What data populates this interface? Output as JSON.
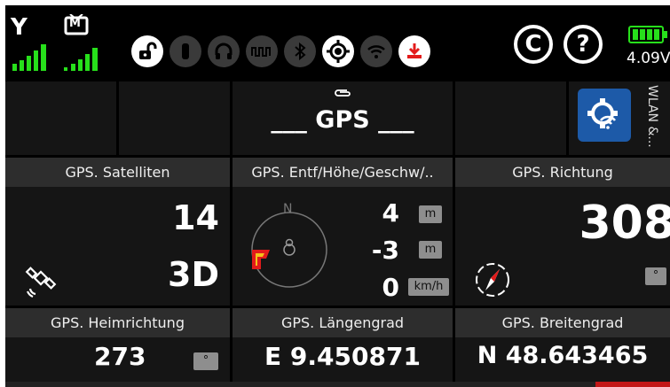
{
  "status": {
    "tx_antenna_glyph": "Y",
    "rx_tv_label": "M",
    "icons": [
      {
        "name": "unlocked-icon",
        "state": "on"
      },
      {
        "name": "vibration-icon",
        "state": "off"
      },
      {
        "name": "headphones-icon",
        "state": "off"
      },
      {
        "name": "sound-wave-icon",
        "state": "off"
      },
      {
        "name": "bluetooth-icon",
        "state": "off"
      },
      {
        "name": "gps-target-icon",
        "state": "on"
      },
      {
        "name": "wifi-icon",
        "state": "off"
      },
      {
        "name": "download-icon",
        "state": "on"
      }
    ],
    "reset_glyph": "C",
    "help_glyph": "?",
    "battery_voltage": "4.09V"
  },
  "top": {
    "title_icon": "paperclip-icon",
    "title": "___ GPS ___",
    "side_label": "WLAN &..."
  },
  "widgets": {
    "satellites": {
      "header": "GPS. Satelliten",
      "count": "14",
      "fix": "3D"
    },
    "distance": {
      "header": "GPS. Entf/Höhe/Geschw/..",
      "compass_north": "N",
      "distance_value": "4",
      "distance_unit": "m",
      "altitude_value": "-3",
      "altitude_unit": "m",
      "speed_value": "0",
      "speed_unit": "km/h"
    },
    "direction": {
      "header": "GPS. Richtung",
      "value": "308",
      "unit": "°"
    },
    "home_direction": {
      "header": "GPS. Heimrichtung",
      "value": "273",
      "unit": "°"
    },
    "longitude": {
      "header": "GPS. Längengrad",
      "value": "E 9.450871"
    },
    "latitude": {
      "header": "GPS. Breitengrad",
      "value": "N 48.643465"
    }
  },
  "colors": {
    "signal_green": "#27e01b",
    "accent_blue": "#1d5aa8",
    "home_red": "#e31b1b",
    "home_yellow": "#f5c21b",
    "header_gray": "#2d2d2d",
    "cell_gray": "#151515"
  }
}
